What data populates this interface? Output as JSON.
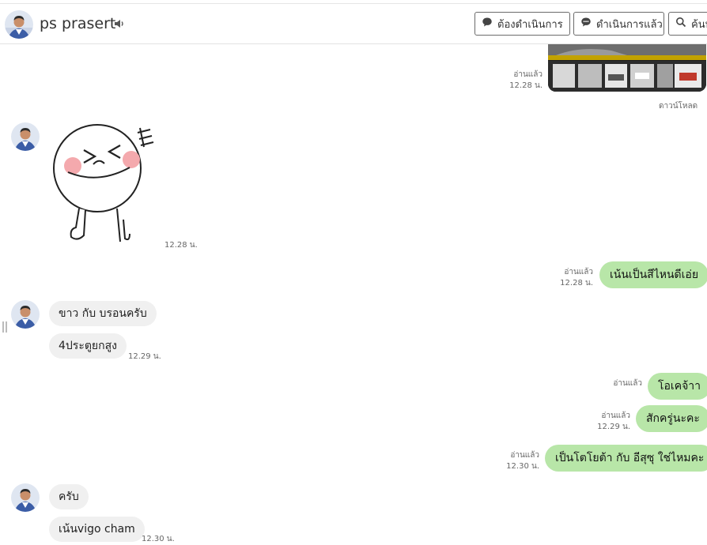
{
  "header": {
    "contact_name": "ps prasert",
    "buttons": {
      "todo": "ต้องดำเนินการ",
      "done": "ดำเนินการแล้ว",
      "search": "ค้นห"
    }
  },
  "messages": {
    "image_meta": {
      "read": "อ่านแล้ว",
      "time": "12.28 น."
    },
    "image_download": "ดาวน์โหลด",
    "sticker_time": "12.28 น.",
    "out1": {
      "text": "เน้นเป็นสีไหนดีเอ่ย",
      "read": "อ่านแล้ว",
      "time": "12.28 น."
    },
    "in1": {
      "text": "ขาว กับ บรอนครับ"
    },
    "in2": {
      "text": "4ประตูยกสูง",
      "time": "12.29 น."
    },
    "out2": {
      "text": "โอเคจ้าา",
      "read": "อ่านแล้ว"
    },
    "out3": {
      "text": "สักครู่นะคะ",
      "read": "อ่านแล้ว",
      "time": "12.29 น."
    },
    "out4": {
      "text": "เป็นโตโยต้า กับ อีสุซุ ใช่ไหมคะ",
      "read": "อ่านแล้ว",
      "time": "12.30 น."
    },
    "in3": {
      "text": "ครับ"
    },
    "in4": {
      "text": "เน้นvigo cham",
      "time": "12.30 น."
    }
  },
  "colors": {
    "outgoing_bubble": "#b8e6a8",
    "incoming_bubble": "#f0f0f0",
    "sticker_cheek": "#f4a9ad"
  },
  "icons": {
    "speaker": "speaker-icon",
    "todo": "chat-bubble-icon",
    "done": "chat-bubble-dots-icon",
    "search": "search-icon"
  }
}
